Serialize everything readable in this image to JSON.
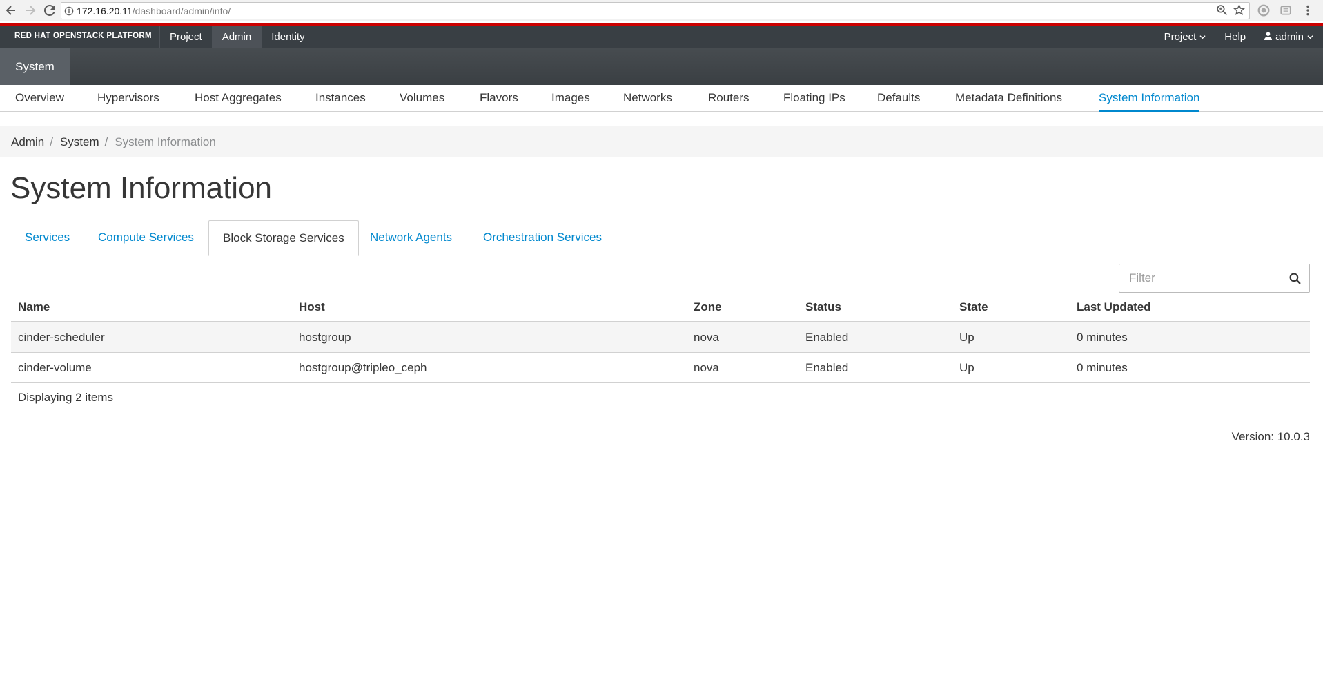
{
  "browser": {
    "url_host": "172.16.20.11",
    "url_path": "/dashboard/admin/info/"
  },
  "header": {
    "brand": "RED HAT OPENSTACK PLATFORM",
    "nav": [
      "Project",
      "Admin",
      "Identity"
    ],
    "right": {
      "project_label": "Project",
      "help_label": "Help",
      "user_label": "admin"
    }
  },
  "section": {
    "label": "System"
  },
  "subnav": [
    "Overview",
    "Hypervisors",
    "Host Aggregates",
    "Instances",
    "Volumes",
    "Flavors",
    "Images",
    "Networks",
    "Routers",
    "Floating IPs",
    "Defaults",
    "Metadata Definitions",
    "System Information"
  ],
  "breadcrumb": [
    "Admin",
    "System",
    "System Information"
  ],
  "page": {
    "title": "System Information"
  },
  "tabs": [
    "Services",
    "Compute Services",
    "Block Storage Services",
    "Network Agents",
    "Orchestration Services"
  ],
  "filter": {
    "placeholder": "Filter"
  },
  "table": {
    "columns": [
      "Name",
      "Host",
      "Zone",
      "Status",
      "State",
      "Last Updated"
    ],
    "rows": [
      [
        "cinder-scheduler",
        "hostgroup",
        "nova",
        "Enabled",
        "Up",
        "0 minutes"
      ],
      [
        "cinder-volume",
        "hostgroup@tripleo_ceph",
        "nova",
        "Enabled",
        "Up",
        "0 minutes"
      ]
    ],
    "footer": "Displaying 2 items"
  },
  "version": "Version: 10.0.3",
  "colors": {
    "accent": "#0088ce",
    "brand_red": "#cc0000",
    "header_bg": "#393f44"
  }
}
